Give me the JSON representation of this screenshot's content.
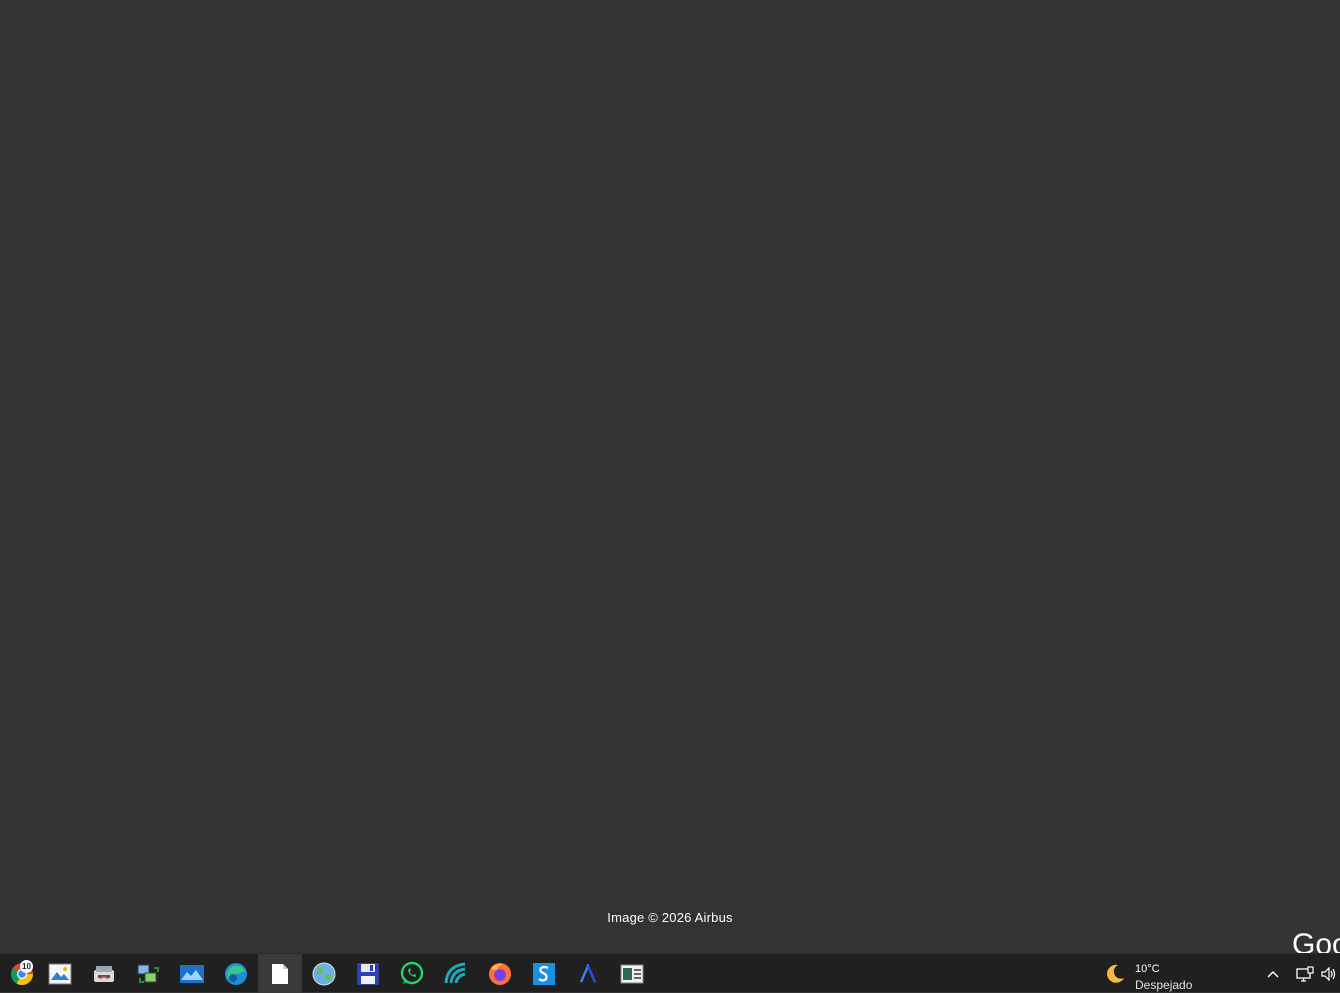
{
  "map": {
    "attribution": "Image © 2026 Airbus",
    "corner_logo_text": "Goo"
  },
  "taskbar": {
    "apps": [
      {
        "name": "chrome-icon",
        "badge": "10"
      },
      {
        "name": "photo-viewer-icon"
      },
      {
        "name": "scanner-icon"
      },
      {
        "name": "network-transfer-icon"
      },
      {
        "name": "photos-icon"
      },
      {
        "name": "edge-icon"
      },
      {
        "name": "blank-document-icon",
        "active": true
      },
      {
        "name": "globe-icon"
      },
      {
        "name": "save-disk-icon"
      },
      {
        "name": "whatsapp-icon"
      },
      {
        "name": "teal-app-icon"
      },
      {
        "name": "firefox-icon"
      },
      {
        "name": "s-app-icon"
      },
      {
        "name": "a-app-icon"
      },
      {
        "name": "reader-icon"
      }
    ],
    "weather": {
      "temperature": "10°C",
      "condition": "Despejado",
      "icon": "moon-icon"
    },
    "tray": [
      {
        "name": "show-hidden-icons-chevron-icon"
      },
      {
        "name": "network-icon"
      },
      {
        "name": "volume-icon"
      }
    ]
  }
}
